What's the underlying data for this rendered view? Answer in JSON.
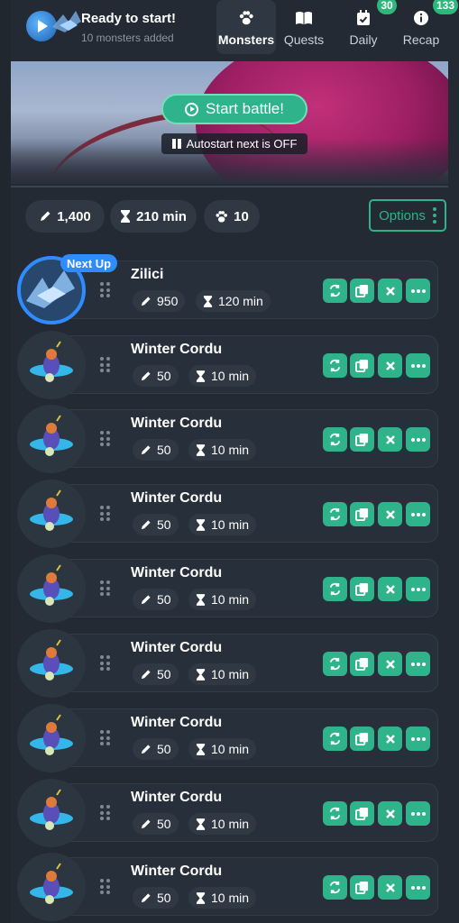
{
  "header": {
    "title": "Ready to start!",
    "subtitle": "10 monsters added",
    "tabs": [
      {
        "label": "Monsters",
        "icon": "paw-icon",
        "active": true,
        "badge": ""
      },
      {
        "label": "Quests",
        "icon": "book-icon",
        "active": false,
        "badge": ""
      },
      {
        "label": "Daily",
        "icon": "calendar-check-icon",
        "active": false,
        "badge": "30"
      },
      {
        "label": "Recap",
        "icon": "info-icon",
        "active": false,
        "badge": "133"
      }
    ]
  },
  "banner": {
    "start_label": "Start battle!",
    "autostart_label": "Autostart next is OFF"
  },
  "stats": {
    "power": "1,400",
    "time": "210 min",
    "count": "10",
    "options_label": "Options"
  },
  "monsters": [
    {
      "name": "Zilici",
      "power": "950",
      "time": "120 min",
      "next_up": "Next Up"
    },
    {
      "name": "Winter Cordu",
      "power": "50",
      "time": "10 min"
    },
    {
      "name": "Winter Cordu",
      "power": "50",
      "time": "10 min"
    },
    {
      "name": "Winter Cordu",
      "power": "50",
      "time": "10 min"
    },
    {
      "name": "Winter Cordu",
      "power": "50",
      "time": "10 min"
    },
    {
      "name": "Winter Cordu",
      "power": "50",
      "time": "10 min"
    },
    {
      "name": "Winter Cordu",
      "power": "50",
      "time": "10 min"
    },
    {
      "name": "Winter Cordu",
      "power": "50",
      "time": "10 min"
    },
    {
      "name": "Winter Cordu",
      "power": "50",
      "time": "10 min"
    }
  ],
  "colors": {
    "accent": "#2fb38a",
    "next_up": "#2f8cff",
    "background": "#232a33"
  }
}
